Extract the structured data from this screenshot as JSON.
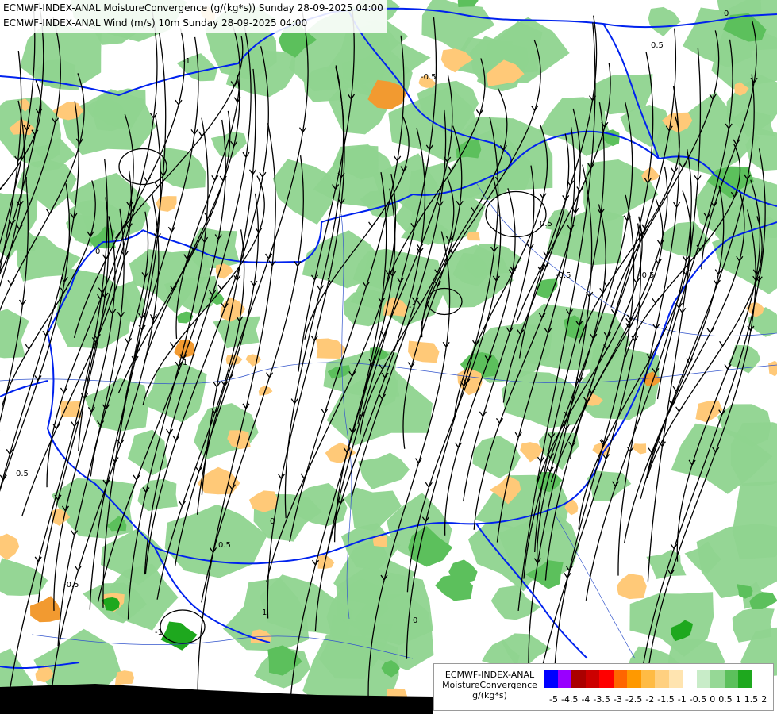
{
  "header": {
    "line1": "ECMWF-INDEX-ANAL MoistureConvergence (g/(kg*s)) Sunday 28-09-2025 04:00",
    "line2": "ECMWF-INDEX-ANAL Wind (m/s) 10m Sunday 28-09-2025 04:00"
  },
  "legend": {
    "title_model": "ECMWF-INDEX-ANAL",
    "title_variable": "MoistureConvergence",
    "title_unit": "g/(kg*s)",
    "tick_labels": [
      "-5",
      "-4.5",
      "-4",
      "-3.5",
      "-3",
      "-2.5",
      "-2",
      "-1.5",
      "-1",
      "-0.5",
      "0",
      "0.5",
      "1",
      "1.5",
      "2"
    ],
    "colors": [
      "#0000ff",
      "#9900ff",
      "#aa0000",
      "#cc0000",
      "#ff0000",
      "#ff6600",
      "#ff9900",
      "#ffbb44",
      "#ffd080",
      "#ffe4b0",
      "#ffffff",
      "#c8ecc8",
      "#96d896",
      "#5cc05c",
      "#1ea81e"
    ]
  },
  "map_labels": [
    "0",
    "0.5",
    "-0.5",
    "-1",
    "1"
  ],
  "colors": {
    "border": "#0022ee",
    "river": "#3355cc",
    "streamline": "#000000",
    "convergence_green": "#8fd48f",
    "divergence_orange": "#ffc978",
    "no_data": "#000000"
  }
}
